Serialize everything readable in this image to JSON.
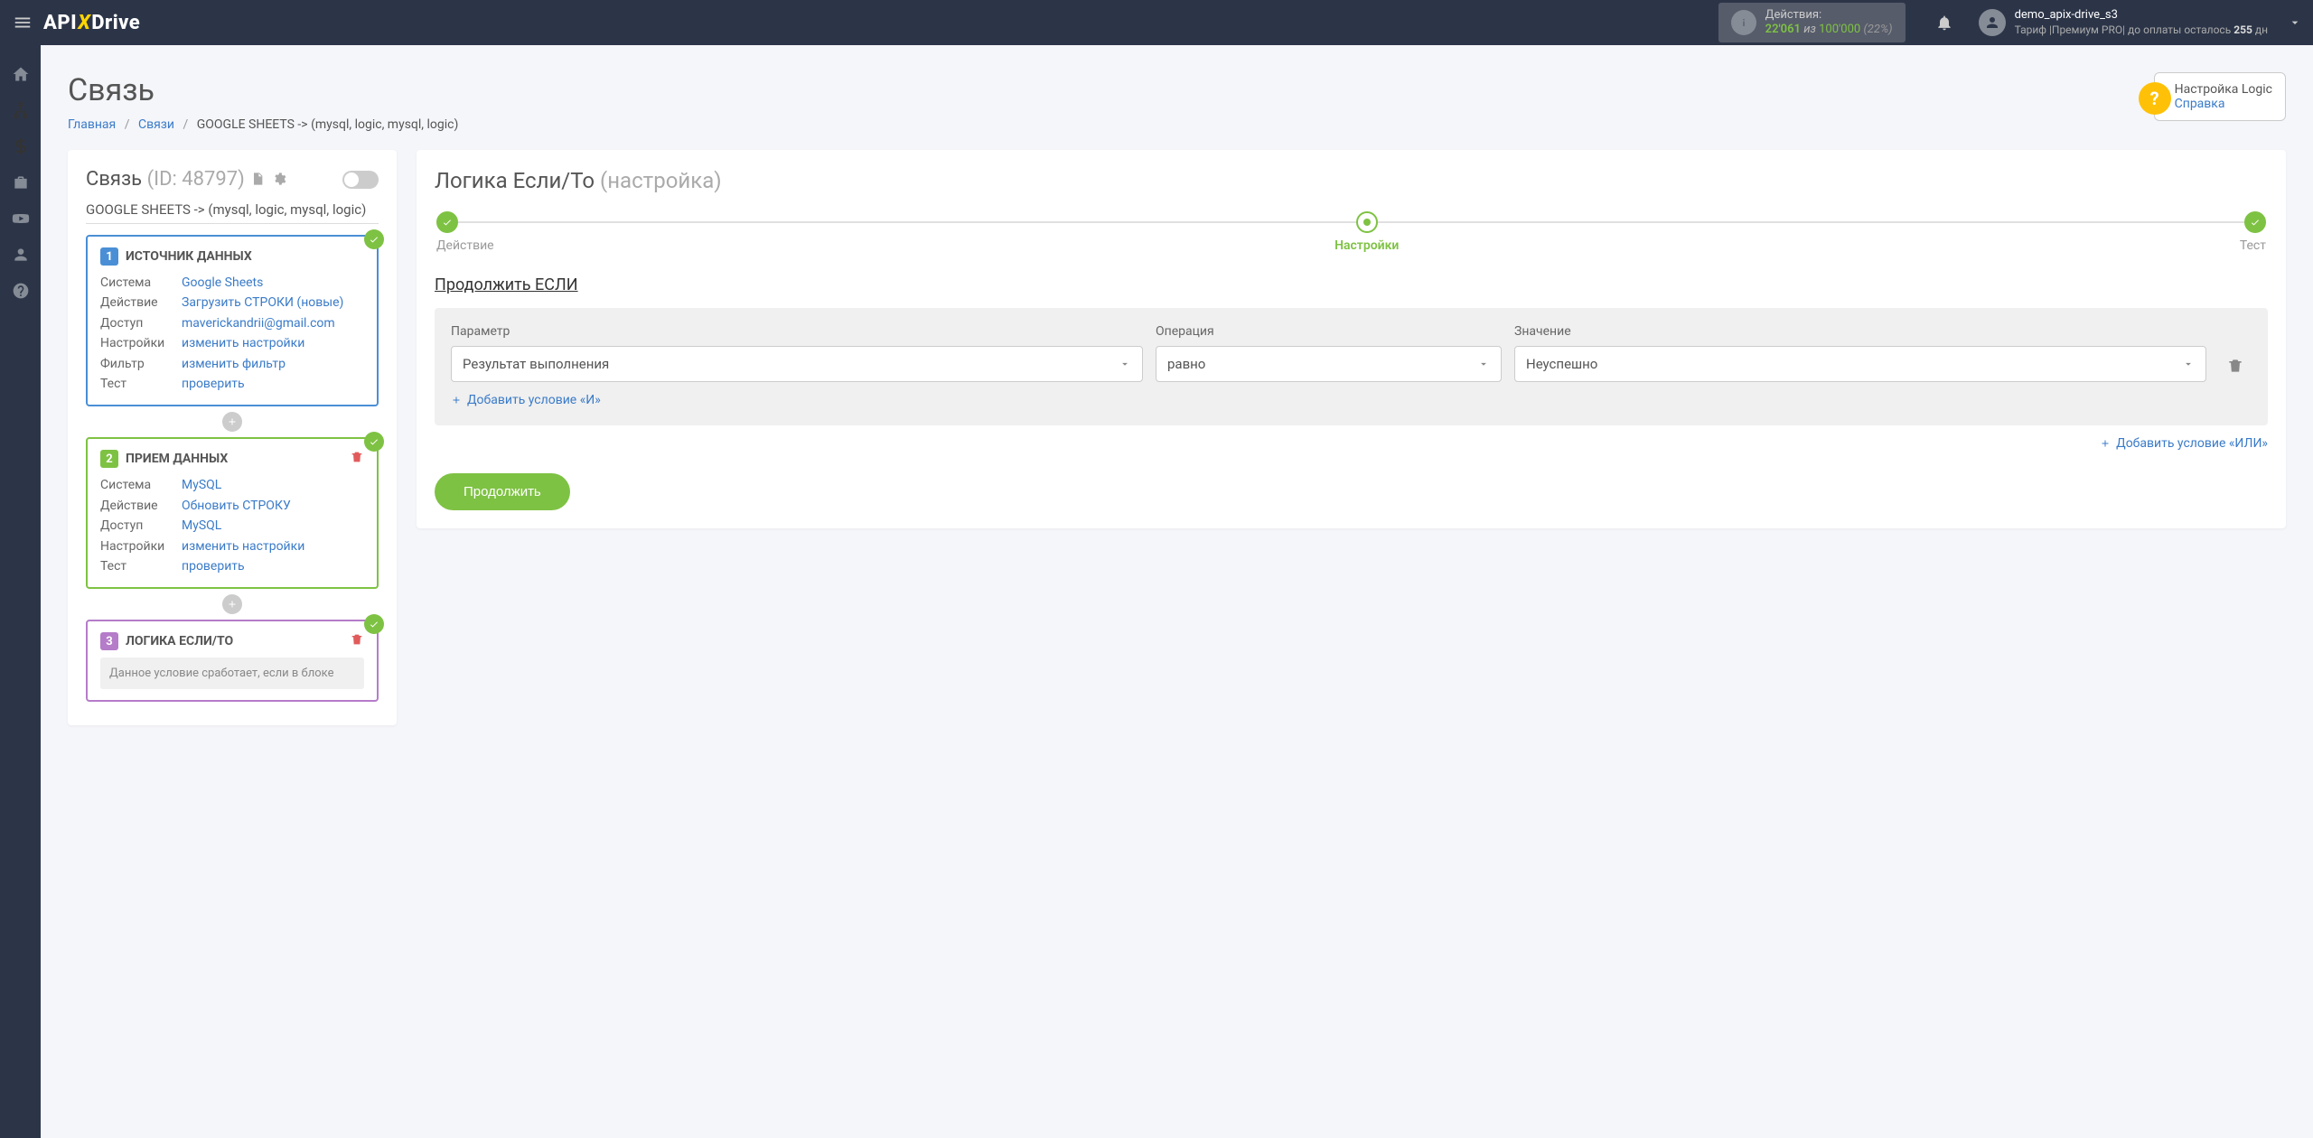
{
  "header": {
    "logo": {
      "api": "API",
      "x": "X",
      "drive": "Drive"
    },
    "actions": {
      "label": "Действия:",
      "used": "22'061",
      "of": "из",
      "total": "100'000",
      "pct": "(22%)"
    },
    "user": {
      "name": "demo_apix-drive_s3",
      "tariff_prefix": "Тариф |Премиум PRO| до оплаты осталось ",
      "days": "255",
      "days_suffix": " дн"
    }
  },
  "page": {
    "title": "Связь",
    "breadcrumb": {
      "home": "Главная",
      "links": "Связи",
      "current": "GOOGLE SHEETS -> (mysql, logic, mysql, logic)"
    },
    "help": {
      "title": "Настройка Logic",
      "link": "Справка"
    }
  },
  "left": {
    "title": "Связь",
    "id": "(ID: 48797)",
    "subtitle": "GOOGLE SHEETS -> (mysql, logic, mysql, logic)",
    "block1": {
      "title": "ИСТОЧНИК ДАННЫХ",
      "rows": {
        "system_l": "Система",
        "system": "Google Sheets",
        "action_l": "Действие",
        "action": "Загрузить СТРОКИ (новые)",
        "access_l": "Доступ",
        "access": "maverickandrii@gmail.com",
        "settings_l": "Настройки",
        "settings": "изменить настройки",
        "filter_l": "Фильтр",
        "filter": "изменить фильтр",
        "test_l": "Тест",
        "test": "проверить"
      }
    },
    "block2": {
      "title": "ПРИЕМ ДАННЫХ",
      "rows": {
        "system_l": "Система",
        "system": "MySQL",
        "action_l": "Действие",
        "action": "Обновить СТРОКУ",
        "access_l": "Доступ",
        "access": "MySQL",
        "settings_l": "Настройки",
        "settings": "изменить настройки",
        "test_l": "Тест",
        "test": "проверить"
      }
    },
    "block3": {
      "title": "ЛОГИКА ЕСЛИ/ТО",
      "info": "Данное условие сработает, если в блоке"
    }
  },
  "right": {
    "title": "Логика Если/То",
    "title_suffix": "(настройка)",
    "steps": {
      "s1": "Действие",
      "s2": "Настройки",
      "s3": "Тест"
    },
    "condition_title": "Продолжить ЕСЛИ",
    "labels": {
      "param": "Параметр",
      "op": "Операция",
      "val": "Значение"
    },
    "values": {
      "param": "Результат выполнения",
      "op": "равно",
      "val": "Неуспешно"
    },
    "add_and": "Добавить условие «И»",
    "add_or": "Добавить условие «ИЛИ»",
    "continue": "Продолжить"
  }
}
